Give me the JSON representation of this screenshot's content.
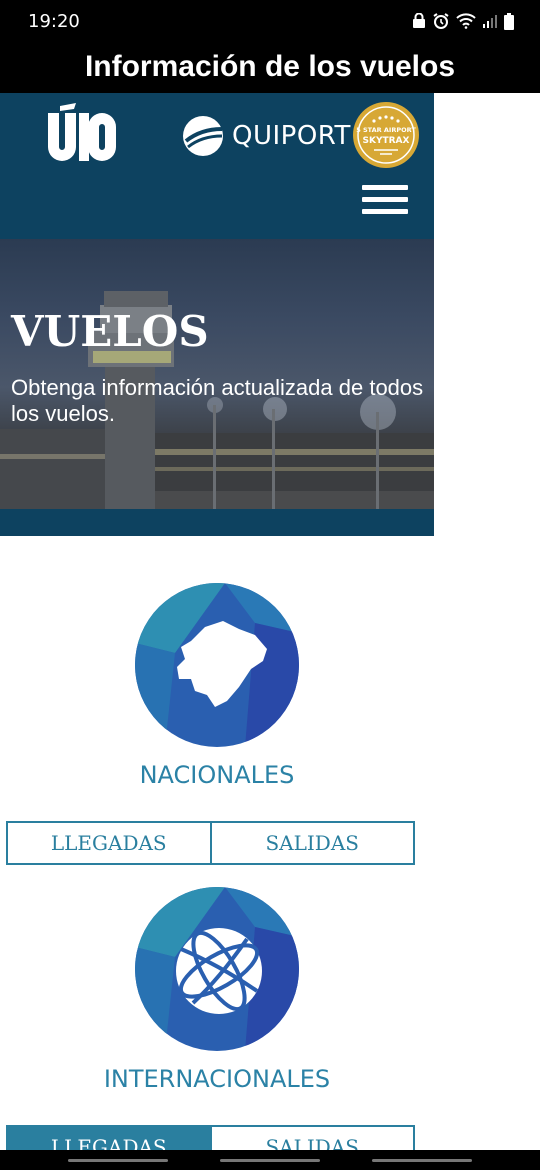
{
  "status": {
    "time": "19:20"
  },
  "app": {
    "title": "Información de los vuelos"
  },
  "site": {
    "logo_text": "UIO",
    "partner": "QUIPORT",
    "badge_lines": [
      "5 STAR AIRPORT",
      "SKYTRAX"
    ]
  },
  "hero": {
    "title": "VUELOS",
    "subtitle": "Obtenga información actualizada de todos los vuelos."
  },
  "nacionales": {
    "label": "NACIONALES",
    "arrivals": "LLEGADAS",
    "departures": "SALIDAS"
  },
  "internacionales": {
    "label": "INTERNACIONALES",
    "arrivals": "LLEGADAS",
    "departures": "SALIDAS"
  },
  "colors": {
    "header": "#0d4260",
    "accent": "#2a7f9f",
    "label": "#2b82a6"
  }
}
